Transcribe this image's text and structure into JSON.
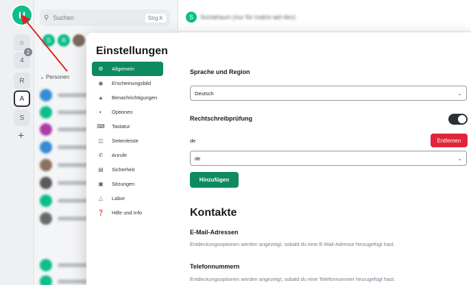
{
  "background": {
    "rail": {
      "home_avatar": "H",
      "notif_count": "4",
      "spaces": [
        "R",
        "A",
        "S"
      ],
      "badge": "2",
      "add": "+"
    },
    "search": {
      "placeholder": "Suchen",
      "shortcut": "Strg K"
    },
    "top_avatars": [
      "S",
      "A"
    ],
    "section_label": "Personen",
    "room_avatar": "S",
    "room_title": "Sozialraum (nur für matrix-ael-dev)"
  },
  "dialog": {
    "title": "Einstellungen",
    "tabs": [
      {
        "label": "Allgemein",
        "icon": "gear-icon"
      },
      {
        "label": "Erscheinungsbild",
        "icon": "eye-icon"
      },
      {
        "label": "Benachrichtigungen",
        "icon": "bell-icon"
      },
      {
        "label": "Optionen",
        "icon": "toggle-icon"
      },
      {
        "label": "Tastatur",
        "icon": "keyboard-icon"
      },
      {
        "label": "Seitenleiste",
        "icon": "sidebar-icon"
      },
      {
        "label": "Anrufe",
        "icon": "phone-icon"
      },
      {
        "label": "Sicherheit",
        "icon": "lock-icon"
      },
      {
        "label": "Sitzungen",
        "icon": "devices-icon"
      },
      {
        "label": "Labor",
        "icon": "flask-icon"
      },
      {
        "label": "Hilfe und Info",
        "icon": "help-icon"
      }
    ],
    "active_tab": "Allgemein",
    "language_region": {
      "heading": "Sprache und Region",
      "language_value": "Deutsch"
    },
    "spellcheck": {
      "heading": "Rechtschreibprüfung",
      "enabled": true,
      "language_code": "de",
      "remove_label": "Entfernen",
      "select_value": "de",
      "add_label": "Hinzufügen"
    },
    "contacts": {
      "heading": "Kontakte",
      "email_heading": "E-Mail-Adressen",
      "email_desc": "Entdeckungsoptionen werden angezeigt, sobald du eine E-Mail-Adresse hinzugefügt hast.",
      "phone_heading": "Telefonnummern",
      "phone_desc": "Entdeckungsoptionen werden angezeigt, sobald du eine Telefonnummer hinzugefügt hast."
    }
  },
  "colors": {
    "accent": "#0d8a5e",
    "danger": "#e0263a",
    "avatar_green": "#0dbd8b"
  }
}
